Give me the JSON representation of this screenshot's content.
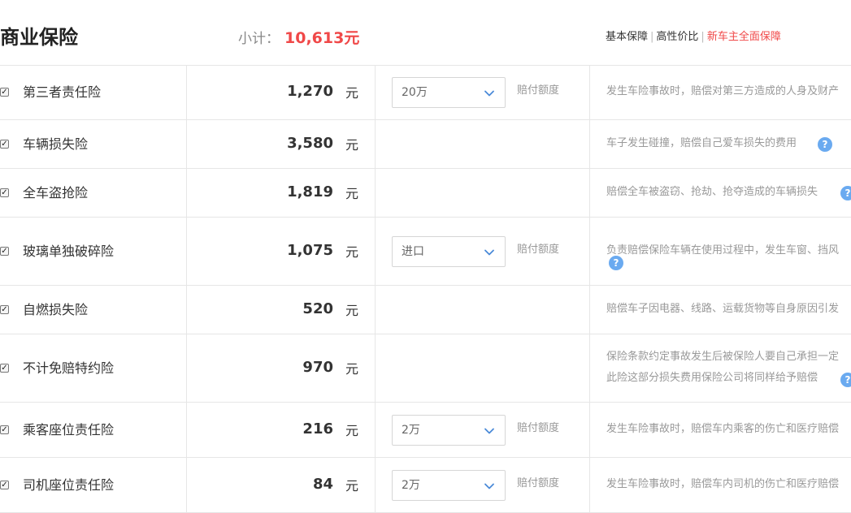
{
  "header": {
    "title": "商业保险",
    "subtotal_label": "小计：",
    "subtotal_value": "10,613元",
    "plans": [
      "基本保障",
      "高性价比",
      "新车主全面保障"
    ]
  },
  "colors": {
    "accent_red": "#f04848",
    "help_blue": "#6aaaf0",
    "border": "#e6e6e6"
  },
  "icons": {
    "checkbox": "checked-checkbox-icon",
    "dropdown": "chevron-down-icon",
    "help": "question-mark-icon"
  },
  "rows": [
    {
      "name": "第三者责任险",
      "price": "1,270",
      "unit": "元",
      "select": "20万",
      "coverage_label": "赔付额度",
      "desc": [
        "发生车险事故时，赔偿对第三方造成的人身及财产"
      ]
    },
    {
      "name": "车辆损失险",
      "price": "3,580",
      "unit": "元",
      "desc": [
        "车子发生碰撞，赔偿自己爱车损失的费用"
      ]
    },
    {
      "name": "全车盗抢险",
      "price": "1,819",
      "unit": "元",
      "desc": [
        "赔偿全车被盗窃、抢劫、抢夺造成的车辆损失"
      ]
    },
    {
      "name": "玻璃单独破碎险",
      "price": "1,075",
      "unit": "元",
      "select": "进口",
      "coverage_label": "赔付额度",
      "desc": [
        "负责赔偿保险车辆在使用过程中，发生车窗、挡风"
      ]
    },
    {
      "name": "自燃损失险",
      "price": "520",
      "unit": "元",
      "desc": [
        "赔偿车子因电器、线路、运载货物等自身原因引发"
      ]
    },
    {
      "name": "不计免赔特约险",
      "price": "970",
      "unit": "元",
      "desc": [
        "保险条款约定事故发生后被保险人要自己承担一定",
        "此险这部分损失费用保险公司将同样给予赔偿"
      ]
    },
    {
      "name": "乘客座位责任险",
      "price": "216",
      "unit": "元",
      "select": "2万",
      "coverage_label": "赔付额度",
      "desc": [
        "发生车险事故时，赔偿车内乘客的伤亡和医疗赔偿"
      ]
    },
    {
      "name": "司机座位责任险",
      "price": "84",
      "unit": "元",
      "select": "2万",
      "coverage_label": "赔付额度",
      "desc": [
        "发生车险事故时，赔偿车内司机的伤亡和医疗赔偿"
      ]
    }
  ]
}
